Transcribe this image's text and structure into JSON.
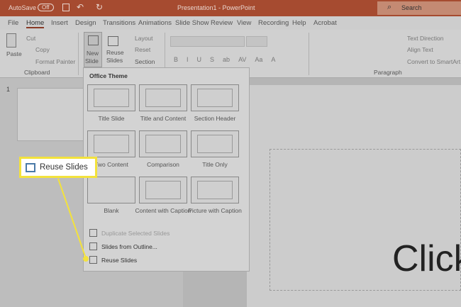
{
  "titlebar": {
    "autosave": "AutoSave",
    "toggle": "Off",
    "title": "Presentation1 - PowerPoint",
    "search": "Search"
  },
  "tabs": [
    "File",
    "Home",
    "Insert",
    "Design",
    "Transitions",
    "Animations",
    "Slide Show",
    "Review",
    "View",
    "Recording",
    "Help",
    "Acrobat"
  ],
  "ribbon": {
    "paste": "Paste",
    "cut": "Cut",
    "copy": "Copy",
    "format_painter": "Format Painter",
    "clipboard": "Clipboard",
    "new_slide": "New",
    "new_slide2": "Slide",
    "reuse": "Reuse",
    "reuse2": "Slides",
    "layout": "Layout",
    "reset": "Reset",
    "section": "Section",
    "text_direction": "Text Direction",
    "align_text": "Align Text",
    "convert": "Convert to SmartArt",
    "paragraph": "Paragraph",
    "font_buttons": [
      "B",
      "I",
      "U",
      "S",
      "ab",
      "AV",
      "Aa",
      "A"
    ]
  },
  "menu": {
    "header": "Office Theme",
    "layouts": [
      "Title Slide",
      "Title and Content",
      "Section Header",
      "Two Content",
      "Comparison",
      "Title Only",
      "Blank",
      "Content with Caption",
      "Picture with Caption"
    ],
    "items": [
      "Duplicate Selected Slides",
      "Slides from Outline...",
      "Reuse Slides"
    ]
  },
  "thumbnail_number": "1",
  "slide_text": "Click",
  "callout": "Reuse Slides"
}
